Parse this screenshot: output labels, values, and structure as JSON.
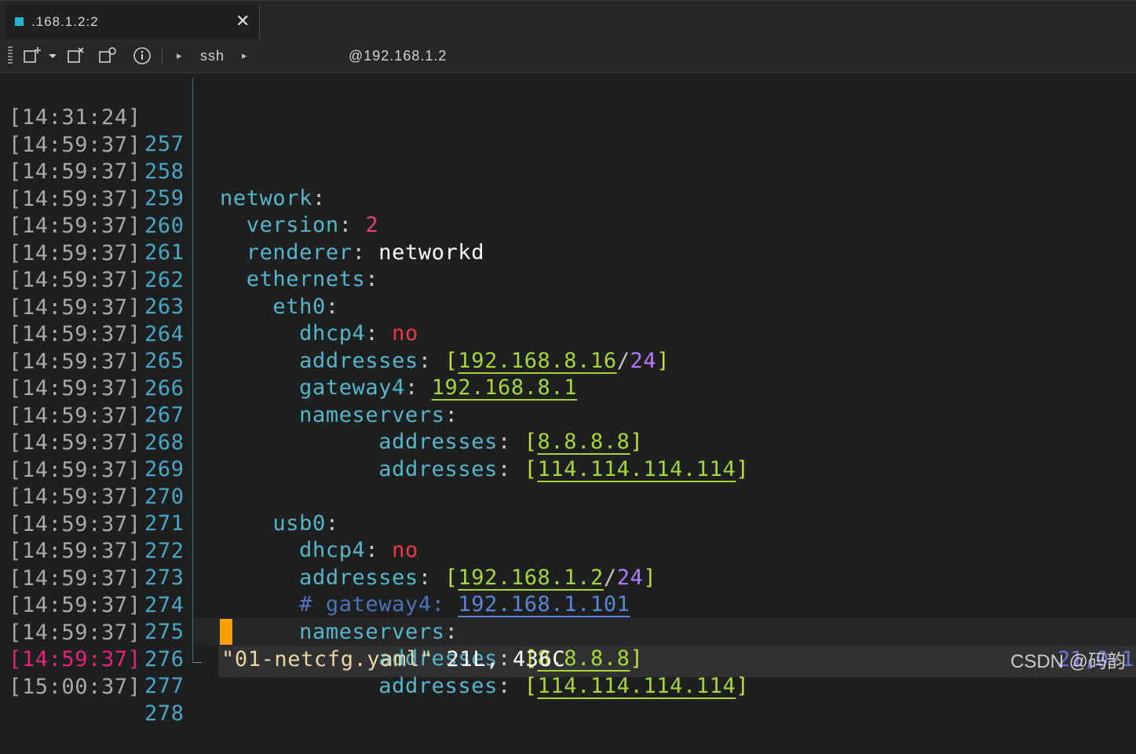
{
  "tab": {
    "title": ".168.1.2:2",
    "close": "✕"
  },
  "toolbar": {
    "items": [
      "new-tab-icon",
      "dropdown-icon",
      "detach-icon",
      "duplicate-icon",
      "info-icon"
    ],
    "breadcrumb": [
      "ssh",
      "@192.168.1.2"
    ]
  },
  "lines": [
    {
      "ts": "[14:31:24]",
      "ln": "257"
    },
    {
      "ts": "[14:59:37]",
      "ln": "258"
    },
    {
      "ts": "[14:59:37]",
      "ln": "259"
    },
    {
      "ts": "[14:59:37]",
      "ln": "260"
    },
    {
      "ts": "[14:59:37]",
      "ln": "261"
    },
    {
      "ts": "[14:59:37]",
      "ln": "262"
    },
    {
      "ts": "[14:59:37]",
      "ln": "263"
    },
    {
      "ts": "[14:59:37]",
      "ln": "264"
    },
    {
      "ts": "[14:59:37]",
      "ln": "265"
    },
    {
      "ts": "[14:59:37]",
      "ln": "266"
    },
    {
      "ts": "[14:59:37]",
      "ln": "267"
    },
    {
      "ts": "[14:59:37]",
      "ln": "268"
    },
    {
      "ts": "[14:59:37]",
      "ln": "269"
    },
    {
      "ts": "[14:59:37]",
      "ln": "270"
    },
    {
      "ts": "[14:59:37]",
      "ln": "271"
    },
    {
      "ts": "[14:59:37]",
      "ln": "272"
    },
    {
      "ts": "[14:59:37]",
      "ln": "273"
    },
    {
      "ts": "[14:59:37]",
      "ln": "274"
    },
    {
      "ts": "[14:59:37]",
      "ln": "275"
    },
    {
      "ts": "[14:59:37]",
      "ln": "276"
    },
    {
      "ts": "[14:59:37]",
      "ln": "277"
    },
    {
      "ts": "[15:00:37]",
      "ln": "278"
    }
  ],
  "code": {
    "network": "network",
    "version_key": "version",
    "version_val": "2",
    "renderer_key": "renderer",
    "renderer_val": "networkd",
    "ethernets": "ethernets",
    "eth0": "eth0",
    "dhcp4": "dhcp4",
    "no": "no",
    "addresses": "addresses",
    "eth0_ip": "192.168.8.16",
    "mask": "24",
    "gateway4": "gateway4",
    "eth0_gw": "192.168.8.1",
    "nameservers": "nameservers",
    "dns1": "8.8.8.8",
    "dns2": "114.114.114.114",
    "usb0": "usb0",
    "usb0_ip": "192.168.1.2",
    "comment": "# gateway4:",
    "comment_gw": "192.168.1.101"
  },
  "status": {
    "filename": "\"01-netcfg.yaml\"",
    "info": " 21L, 436C",
    "position": "21,0-1"
  },
  "watermark": "CSDN @码韵",
  "colors": {
    "background": "#1e1f1f",
    "timestamp": "#a9a9a9",
    "timestamp_current": "#e6257a",
    "line_number": "#4aa6c6",
    "key": "#57b5cc",
    "number": "#e0446a",
    "ip": "#a8d53a",
    "cursor": "#f59e00"
  }
}
